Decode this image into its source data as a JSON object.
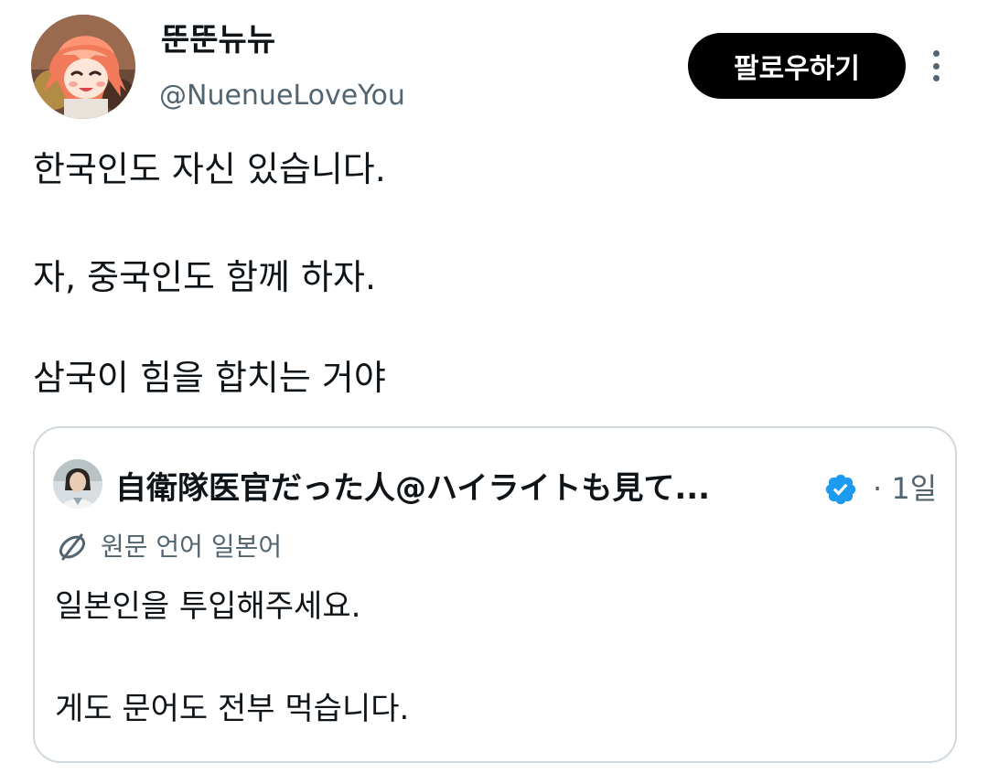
{
  "author": {
    "display_name": "뚠뚠뉴뉴",
    "handle": "@NuenueLoveYou",
    "avatar": "anime-character-avatar"
  },
  "actions": {
    "follow_label": "팔로우하기",
    "more_icon": "more-vertical-icon"
  },
  "tweet": {
    "lines": [
      "한국인도 자신 있습니다.",
      "자, 중국인도 함께 하자.",
      "삼국이 힘을 합치는 거야"
    ]
  },
  "quoted_tweet": {
    "author_name": "自衛隊医官だった人@ハイライトも見て...",
    "avatar": "person-photo-avatar",
    "verified_icon": "verified-badge-icon",
    "time": "· 1일",
    "translate_label": "원문 언어 일본어",
    "translate_icon": "translate-globe-icon",
    "lines": [
      "일본인을 투입해주세요.",
      "게도 문어도 전부 먹습니다."
    ]
  },
  "colors": {
    "text_primary": "#0f1419",
    "text_secondary": "#536471",
    "follow_button_bg": "#000000",
    "verified_blue": "#1d9bf0",
    "card_border": "#cfd9de"
  }
}
